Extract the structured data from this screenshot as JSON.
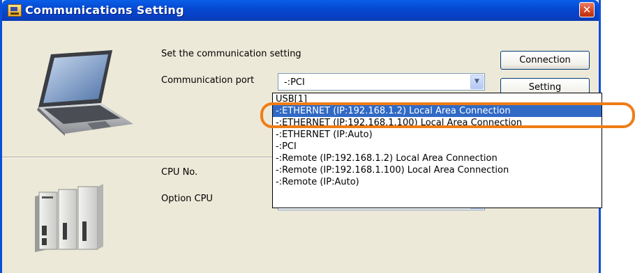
{
  "window": {
    "title": "Communications Setting",
    "close_glyph": "✕"
  },
  "instruction": "Set the communication setting",
  "communication_port": {
    "label": "Communication port",
    "value": "-:PCI"
  },
  "buttons": {
    "connection": "Connection",
    "setting": "Setting"
  },
  "cpu_no": {
    "label": "CPU No."
  },
  "option_cpu": {
    "label": "Option CPU"
  },
  "dropdown": {
    "options": [
      "USB[1]",
      "-:ETHERNET  (IP:192.168.1.2) Local Area Connection",
      "-:ETHERNET  (IP:192.168.1.100) Local Area Connection",
      "-:ETHERNET  (IP:Auto)",
      "-:PCI",
      "-:Remote  (IP:192.168.1.2) Local Area Connection",
      "-:Remote  (IP:192.168.1.100) Local Area Connection",
      "-:Remote  (IP:Auto)"
    ],
    "selected": "-:ETHERNET  (IP:192.168.1.2) Local Area Connection"
  },
  "colors": {
    "titlebar": "#0548cf",
    "selection": "#316ac5",
    "callout": "#ee7d16",
    "dialog_bg": "#ece9d8"
  },
  "icons": [
    "app-icon",
    "close-icon",
    "combo-arrow-icon",
    "laptop-icon",
    "plc-controller-icon"
  ]
}
